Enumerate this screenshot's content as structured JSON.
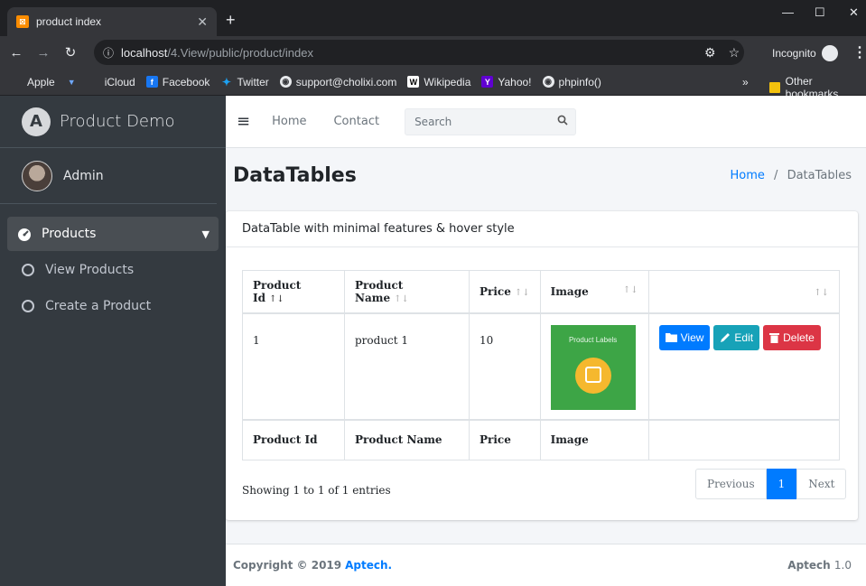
{
  "browser": {
    "tab_title": "product index",
    "tab_favicon": "xampp-icon",
    "url_host": "localhost",
    "url_path": "/4.View/public/product/index",
    "incognito_label": "Incognito",
    "bookmarks": [
      "Apple",
      "iCloud",
      "Facebook",
      "Twitter",
      "support@cholixi.com",
      "Wikipedia",
      "Yahoo!",
      "phpinfo()"
    ],
    "other_bookmarks": "Other bookmarks",
    "more_glyph": "»"
  },
  "sidebar": {
    "brand": "Product Demo",
    "user": "Admin",
    "menu": {
      "label": "Products",
      "items": [
        "View Products",
        "Create a Product"
      ]
    }
  },
  "topnav": {
    "links": [
      "Home",
      "Contact"
    ],
    "search_placeholder": "Search"
  },
  "page": {
    "title": "DataTables",
    "breadcrumb": [
      "Home",
      "DataTables"
    ],
    "breadcrumb_sep": "/"
  },
  "card": {
    "title": "DataTable with minimal features & hover style",
    "columns": [
      "Product Id",
      "Product Name",
      "Price",
      "Image"
    ],
    "rows": [
      {
        "id": "1",
        "name": "product 1",
        "price": "10",
        "image_caption": "Product Labels"
      }
    ],
    "actions": {
      "view": "View",
      "edit": "Edit",
      "delete": "Delete"
    },
    "info": "Showing 1 to 1 of 1 entries",
    "pagination": {
      "previous": "Previous",
      "page": "1",
      "next": "Next"
    }
  },
  "footer": {
    "copyright": "Copyright © 2019",
    "brand": "Aptech.",
    "version_name": "Aptech",
    "version": "1.0"
  },
  "colors": {
    "primary": "#007bff",
    "info": "#17a2b8",
    "danger": "#dc3545",
    "sidebar": "#343a40"
  }
}
